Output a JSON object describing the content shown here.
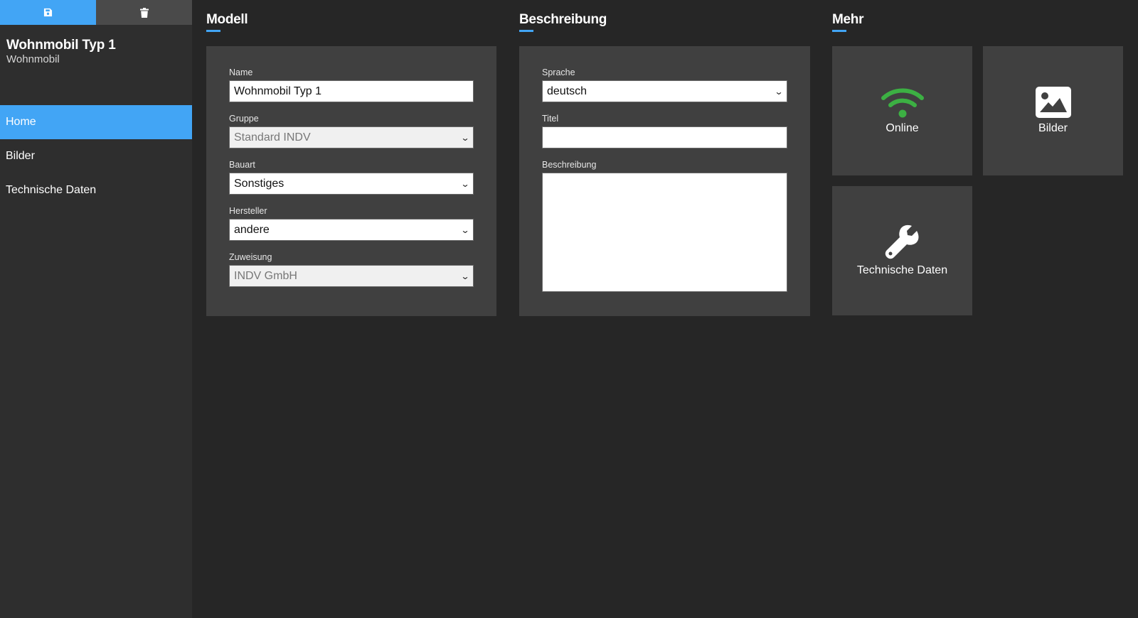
{
  "sidebar": {
    "actions": [
      {
        "icon": "save-icon"
      },
      {
        "icon": "trash-icon"
      }
    ],
    "record_title": "Wohnmobil Typ 1",
    "record_subtitle": "Wohnmobil",
    "nav": [
      {
        "label": "Home",
        "active": true
      },
      {
        "label": "Bilder",
        "active": false
      },
      {
        "label": "Technische Daten",
        "active": false
      }
    ]
  },
  "sections": {
    "modell": {
      "title": "Modell",
      "fields": {
        "name": {
          "label": "Name",
          "value": "Wohnmobil Typ 1"
        },
        "gruppe": {
          "label": "Gruppe",
          "value": "Standard INDV"
        },
        "bauart": {
          "label": "Bauart",
          "value": "Sonstiges"
        },
        "hersteller": {
          "label": "Hersteller",
          "value": "andere"
        },
        "zuweisung": {
          "label": "Zuweisung",
          "value": "INDV GmbH"
        }
      }
    },
    "beschreibung": {
      "title": "Beschreibung",
      "fields": {
        "sprache": {
          "label": "Sprache",
          "value": "deutsch"
        },
        "titel": {
          "label": "Titel",
          "value": ""
        },
        "beschreibung": {
          "label": "Beschreibung",
          "value": ""
        }
      }
    },
    "mehr": {
      "title": "Mehr",
      "tiles": [
        {
          "label": "Online",
          "icon": "wifi-icon",
          "color": "#3cb043"
        },
        {
          "label": "Bilder",
          "icon": "image-icon",
          "color": "#ffffff"
        },
        {
          "label": "Technische Daten",
          "icon": "wrench-icon",
          "color": "#ffffff"
        }
      ]
    }
  },
  "colors": {
    "accent": "#42a5f5",
    "background": "#262626",
    "sidebar": "#2e2e2e",
    "panel": "#404040",
    "online": "#3cb043"
  }
}
